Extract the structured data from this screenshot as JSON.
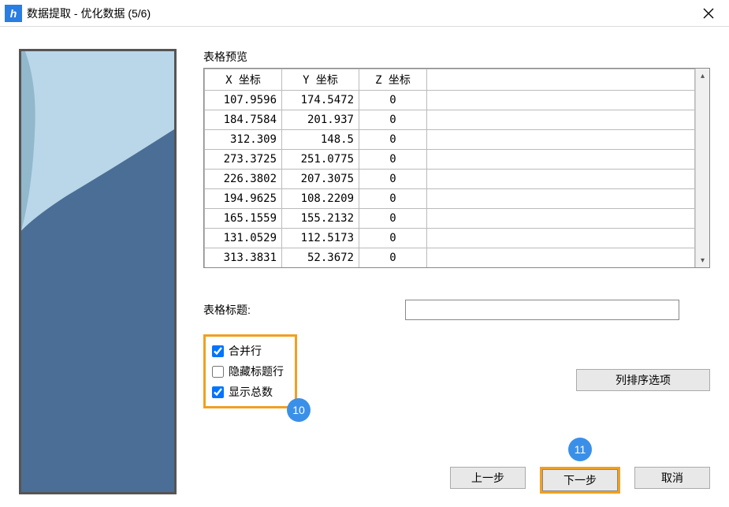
{
  "window": {
    "title": "数据提取 - 优化数据 (5/6)"
  },
  "preview": {
    "label": "表格预览"
  },
  "table": {
    "headers": [
      "X 坐标",
      "Y 坐标",
      "Z 坐标"
    ],
    "rows": [
      [
        "107.9596",
        "174.5472",
        "0"
      ],
      [
        "184.7584",
        "201.937",
        "0"
      ],
      [
        "312.309",
        "148.5",
        "0"
      ],
      [
        "273.3725",
        "251.0775",
        "0"
      ],
      [
        "226.3802",
        "207.3075",
        "0"
      ],
      [
        "194.9625",
        "108.2209",
        "0"
      ],
      [
        "165.1559",
        "155.2132",
        "0"
      ],
      [
        "131.0529",
        "112.5173",
        "0"
      ],
      [
        "313.3831",
        "52.3672",
        "0"
      ]
    ]
  },
  "form": {
    "title_label": "表格标题:",
    "title_value": "",
    "merge_rows_label": "合并行",
    "merge_rows_checked": true,
    "hide_header_label": "隐藏标题行",
    "hide_header_checked": false,
    "show_total_label": "显示总数",
    "show_total_checked": true,
    "col_sort_label": "列排序选项"
  },
  "buttons": {
    "prev": "上一步",
    "next": "下一步",
    "cancel": "取消"
  },
  "badges": {
    "b10": "10",
    "b11": "11"
  }
}
